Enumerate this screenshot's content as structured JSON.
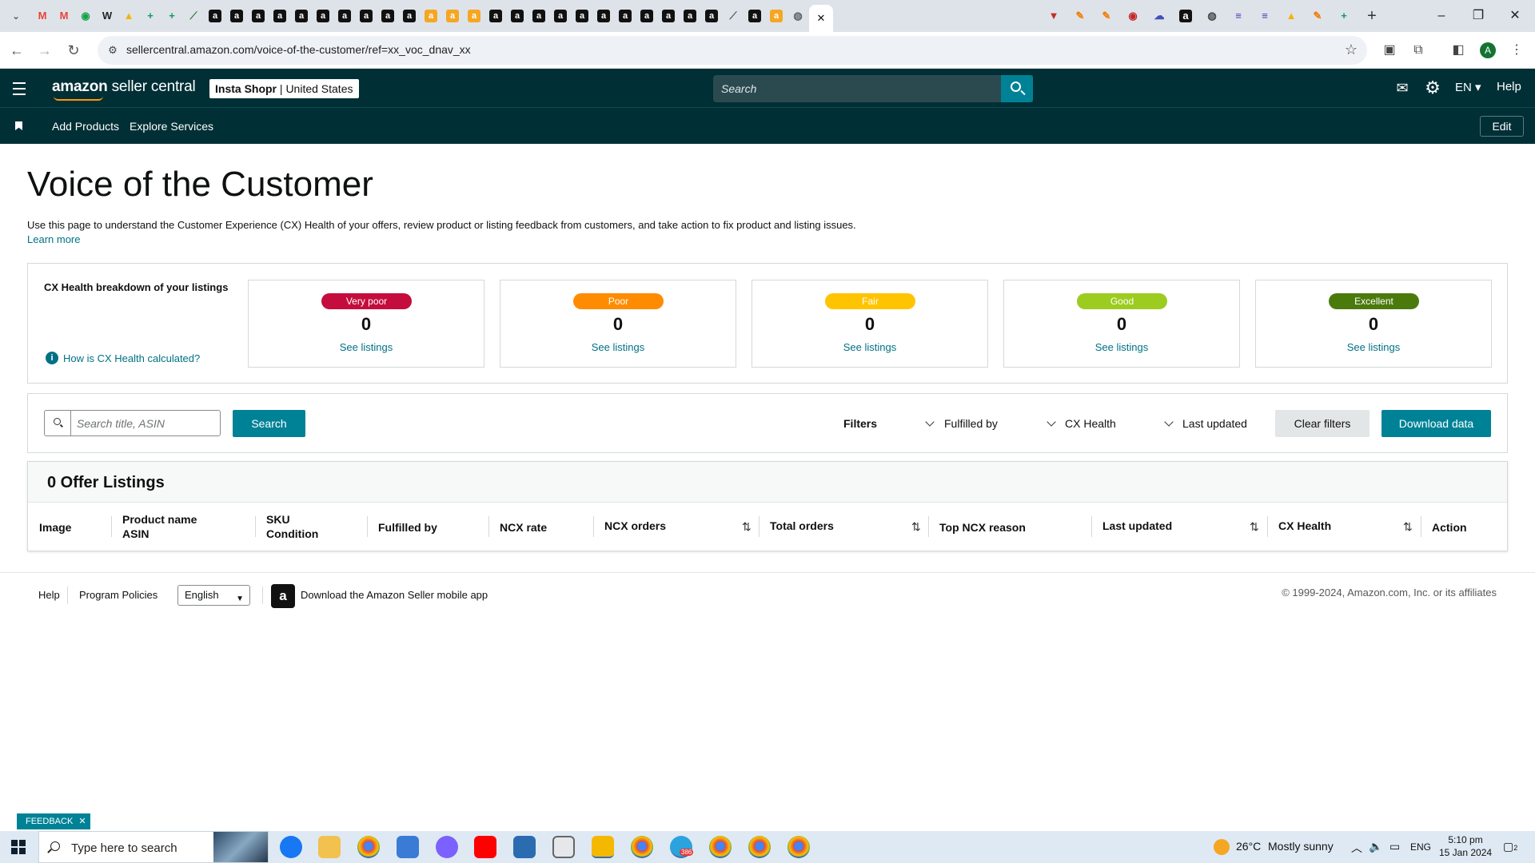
{
  "browser": {
    "url": "sellercentral.amazon.com/voice-of-the-customer/ref=xx_voc_dnav_xx",
    "tab_favicons": [
      {
        "name": "gmail-icon",
        "glyph": "M",
        "color": "#ea4335"
      },
      {
        "name": "gmail-icon",
        "glyph": "M",
        "color": "#ea4335"
      },
      {
        "name": "chat-icon",
        "glyph": "◉",
        "color": "#16a34a"
      },
      {
        "name": "wix-icon",
        "glyph": "W",
        "color": "#222222"
      },
      {
        "name": "drive-icon",
        "glyph": "▲",
        "color": "#f4b400"
      },
      {
        "name": "sheets-icon",
        "glyph": "+",
        "color": "#0f9d58"
      },
      {
        "name": "sheets-icon",
        "glyph": "+",
        "color": "#0f9d58"
      },
      {
        "name": "slack-icon",
        "glyph": "⟋",
        "color": "#2e7d32"
      },
      {
        "name": "amazon-icon",
        "glyph": "a",
        "color": "#111111"
      },
      {
        "name": "amazon-icon",
        "glyph": "a",
        "color": "#111111"
      },
      {
        "name": "amazon-icon",
        "glyph": "a",
        "color": "#111111"
      },
      {
        "name": "amazon-icon",
        "glyph": "a",
        "color": "#111111"
      },
      {
        "name": "amazon-icon",
        "glyph": "a",
        "color": "#111111"
      },
      {
        "name": "amazon-icon",
        "glyph": "a",
        "color": "#111111"
      },
      {
        "name": "amazon-icon",
        "glyph": "a",
        "color": "#111111"
      },
      {
        "name": "amazon-icon",
        "glyph": "a",
        "color": "#111111"
      },
      {
        "name": "amazon-icon",
        "glyph": "a",
        "color": "#111111"
      },
      {
        "name": "amazon-icon",
        "glyph": "a",
        "color": "#111111"
      },
      {
        "name": "amazon-smile-icon",
        "glyph": "a",
        "color": "#ffffff"
      },
      {
        "name": "amazon-smile-icon",
        "glyph": "a",
        "color": "#ffffff"
      },
      {
        "name": "amazon-smile-icon",
        "glyph": "a",
        "color": "#ffffff"
      },
      {
        "name": "amazon-icon",
        "glyph": "a",
        "color": "#111111"
      },
      {
        "name": "amazon-icon",
        "glyph": "a",
        "color": "#111111"
      },
      {
        "name": "amazon-icon",
        "glyph": "a",
        "color": "#111111"
      },
      {
        "name": "amazon-icon",
        "glyph": "a",
        "color": "#111111"
      },
      {
        "name": "amazon-icon",
        "glyph": "a",
        "color": "#111111"
      },
      {
        "name": "amazon-icon",
        "glyph": "a",
        "color": "#111111"
      },
      {
        "name": "amazon-icon",
        "glyph": "a",
        "color": "#111111"
      },
      {
        "name": "amazon-icon",
        "glyph": "a",
        "color": "#111111"
      },
      {
        "name": "amazon-icon",
        "glyph": "a",
        "color": "#111111"
      },
      {
        "name": "amazon-icon",
        "glyph": "a",
        "color": "#111111"
      },
      {
        "name": "amazon-icon",
        "glyph": "a",
        "color": "#111111"
      },
      {
        "name": "tool-icon",
        "glyph": "⟋",
        "color": "#555555"
      },
      {
        "name": "amazon-icon",
        "glyph": "a",
        "color": "#111111"
      },
      {
        "name": "amazon-smile-icon",
        "glyph": "a",
        "color": "#ffffff"
      },
      {
        "name": "globe-icon",
        "glyph": "◍",
        "color": "#5f6368"
      }
    ],
    "tab_favicons_right": [
      {
        "name": "shield-icon",
        "glyph": "▼",
        "color": "#c62828"
      },
      {
        "name": "pen-icon",
        "glyph": "✎",
        "color": "#f57c00"
      },
      {
        "name": "pen-icon",
        "glyph": "✎",
        "color": "#f57c00"
      },
      {
        "name": "record-icon",
        "glyph": "◉",
        "color": "#c62828"
      },
      {
        "name": "cloud-icon",
        "glyph": "☁",
        "color": "#3f51b5"
      },
      {
        "name": "amazon-icon",
        "glyph": "a",
        "color": "#111111"
      },
      {
        "name": "github-icon",
        "glyph": "◍",
        "color": "#444444"
      },
      {
        "name": "docs-icon",
        "glyph": "≡",
        "color": "#5e35b1"
      },
      {
        "name": "docs-icon",
        "glyph": "≡",
        "color": "#5e35b1"
      },
      {
        "name": "drive-icon",
        "glyph": "▲",
        "color": "#f4b400"
      },
      {
        "name": "pen-icon",
        "glyph": "✎",
        "color": "#f57c00"
      },
      {
        "name": "sheets-icon",
        "glyph": "+",
        "color": "#0f9d58"
      }
    ],
    "profile_initial": "A"
  },
  "header": {
    "logo_bold": "amazon",
    "logo_rest": " seller central",
    "store_name": "Insta Shopr",
    "store_region": "United States",
    "search_placeholder": "Search",
    "language": "EN",
    "help": "Help"
  },
  "subnav": {
    "add_products": "Add Products",
    "explore_services": "Explore Services",
    "edit": "Edit"
  },
  "page": {
    "title": "Voice of the Customer",
    "description": "Use this page to understand the Customer Experience (CX) Health of your offers, review product or listing feedback from customers, and take action to fix product and listing issues.",
    "learn_more": "Learn more"
  },
  "cx_health": {
    "title": "CX Health breakdown of your listings",
    "how_calculated": "How is CX Health calculated?",
    "cards": [
      {
        "label": "Very poor",
        "count": "0",
        "link": "See listings",
        "color": "#c40d3c"
      },
      {
        "label": "Poor",
        "count": "0",
        "link": "See listings",
        "color": "#ff8c00"
      },
      {
        "label": "Fair",
        "count": "0",
        "link": "See listings",
        "color": "#ffc400"
      },
      {
        "label": "Good",
        "count": "0",
        "link": "See listings",
        "color": "#9ccc1f"
      },
      {
        "label": "Excellent",
        "count": "0",
        "link": "See listings",
        "color": "#4a7a0c"
      }
    ]
  },
  "filters": {
    "search_placeholder": "Search title, ASIN",
    "search_button": "Search",
    "filters_label": "Filters",
    "fulfilled_by": "Fulfilled by",
    "cx_health": "CX Health",
    "last_updated": "Last updated",
    "clear_filters": "Clear filters",
    "download_data": "Download data"
  },
  "listings": {
    "title": "0 Offer Listings",
    "columns": {
      "image": "Image",
      "product_name": "Product name",
      "asin": "ASIN",
      "sku": "SKU",
      "condition": "Condition",
      "fulfilled_by": "Fulfilled by",
      "ncx_rate": "NCX rate",
      "ncx_orders": "NCX orders",
      "total_orders": "Total orders",
      "top_ncx_reason": "Top NCX reason",
      "last_updated": "Last updated",
      "cx_health": "CX Health",
      "action": "Action"
    }
  },
  "footer": {
    "help": "Help",
    "program_policies": "Program Policies",
    "language": "English",
    "download_app": "Download the Amazon Seller mobile app",
    "copyright": "© 1999-2024, Amazon.com, Inc. or its affiliates",
    "feedback": "FEEDBACK"
  },
  "taskbar": {
    "search_placeholder": "Type here to search",
    "weather_temp": "26°C",
    "weather_desc": "Mostly sunny",
    "input_lang": "ENG",
    "time": "5:10 pm",
    "date": "15 Jan 2024",
    "notification_count": "2",
    "telegram_badge": "386"
  }
}
